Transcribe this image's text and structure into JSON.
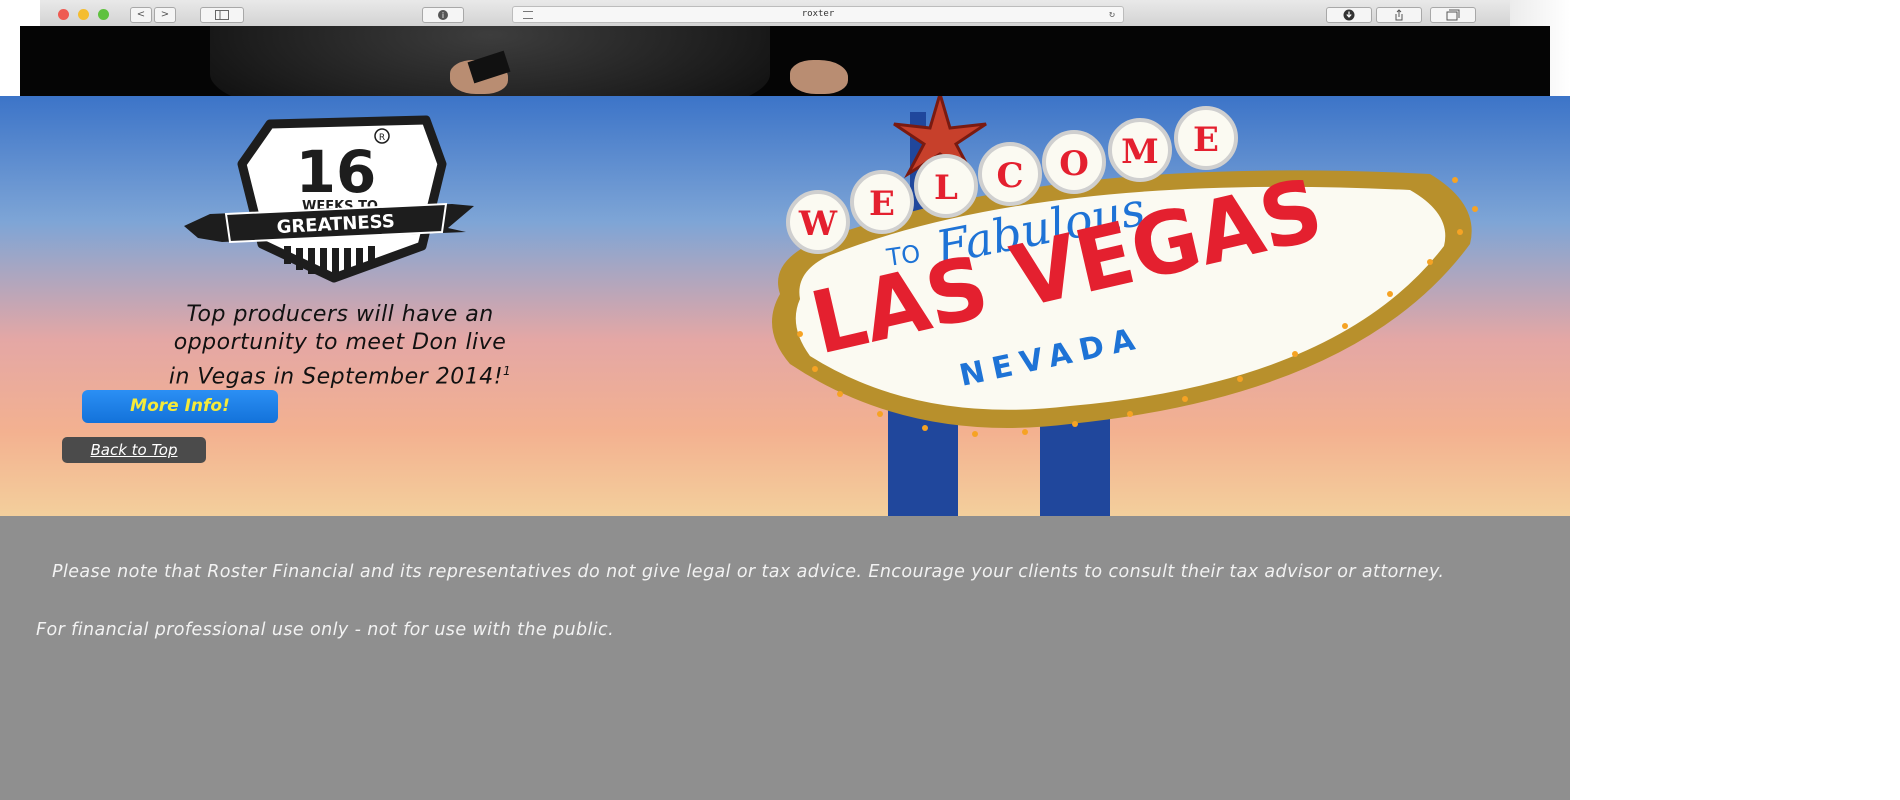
{
  "browser": {
    "url": "roxter",
    "back_glyph": "<",
    "forward_glyph": ">",
    "reload_glyph": "↻",
    "new_tab_glyph": "+",
    "info_glyph": "i"
  },
  "colors": {
    "banner_top": "#3c74c8",
    "banner_bottom": "#f3cf9c",
    "more_button_bg": "#1f84ec",
    "more_button_text": "#f5ea3a",
    "back_button_bg": "#4b4b4b",
    "footer_bg": "#8f8f8f",
    "sign_red": "#e4202f",
    "sign_blue": "#1e73d6"
  },
  "badge": {
    "number": "16",
    "subtitle": "WEEKS TO",
    "ribbon_text": "GREATNESS",
    "corner_mark": "R"
  },
  "promo": {
    "text_line1": "Top producers will have an",
    "text_line2": "opportunity to meet Don live",
    "text_line3": "in Vegas in September 2014!",
    "footnote_mark": "1"
  },
  "buttons": {
    "more_info": "More Info!",
    "back_to_top": "Back to Top"
  },
  "sign": {
    "welcome_letters": [
      "W",
      "E",
      "L",
      "C",
      "O",
      "M",
      "E"
    ],
    "to": "TO",
    "fabulous": "Fabulous",
    "las_vegas": "LAS VEGAS",
    "nevada": "NEVADA"
  },
  "footer": {
    "disclaimer": "Please note that Roster Financial and its representatives do not give legal or tax advice. Encourage your clients to consult their tax advisor or attorney.",
    "professional_use": "For financial professional use only - not for use with the public."
  }
}
